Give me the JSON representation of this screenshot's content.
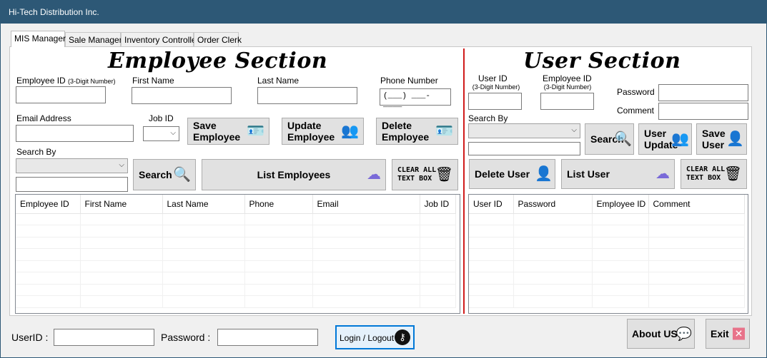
{
  "window": {
    "title": "Hi-Tech Distribution Inc."
  },
  "tabs": [
    {
      "label": "MIS Manager"
    },
    {
      "label": "Sale Manager"
    },
    {
      "label": "Inventory Controller"
    },
    {
      "label": "Order Clerk"
    }
  ],
  "employee": {
    "heading": "Employee Section",
    "employee_id_label": "Employee ID",
    "employee_id_hint": "(3-Digit Number)",
    "first_name_label": "First Name",
    "last_name_label": "Last Name",
    "phone_label": "Phone Number",
    "phone_mask": "(___) ___-____",
    "email_label": "Email Address",
    "job_id_label": "Job ID",
    "search_by_label": "Search By",
    "save_label": "Save\nEmployee",
    "update_label": "Update\nEmployee",
    "delete_label": "Delete\nEmployee",
    "search_label": "Search",
    "list_label": "List Employees",
    "clear_label": "CLEAR ALL\nTEXT BOX",
    "grid_columns": [
      "Employee ID",
      "First Name",
      "Last Name",
      "Phone",
      "Email",
      "Job ID"
    ]
  },
  "user": {
    "heading": "User Section",
    "user_id_label": "User ID",
    "user_id_hint": "(3-Digit Number)",
    "employee_id_label": "Employee ID",
    "employee_id_hint": "(3-Digit Number)",
    "password_label": "Password",
    "comment_label": "Comment",
    "search_by_label": "Search By",
    "search_label": "Search",
    "update_label": "User\nUpdate",
    "save_label": "Save\nUser",
    "delete_label": "Delete User",
    "list_label": "List User",
    "clear_label": "CLEAR ALL\nTEXT BOX",
    "grid_columns": [
      "User ID",
      "Password",
      "Employee ID",
      "Comment"
    ]
  },
  "footer": {
    "userid_label": "UserID :",
    "password_label": "Password :",
    "login_label": "Login / Logout",
    "about_label": "About US",
    "exit_label": "Exit"
  },
  "icons": {
    "save": "id-card-add-icon",
    "update": "users-icon",
    "delete": "id-card-delete-icon",
    "search": "magnifier-icon",
    "list": "cloud-upload-icon",
    "clear": "trash-icon",
    "delete_user": "user-delete-icon",
    "save_user": "user-add-icon",
    "key": "key-icon",
    "about": "chat-info-icon",
    "exit": "close-box-icon"
  },
  "colors": {
    "titlebar": "#2d5876",
    "divider": "#d01c1c",
    "focus_border": "#0078d7",
    "exit_icon": "#e8738a"
  }
}
